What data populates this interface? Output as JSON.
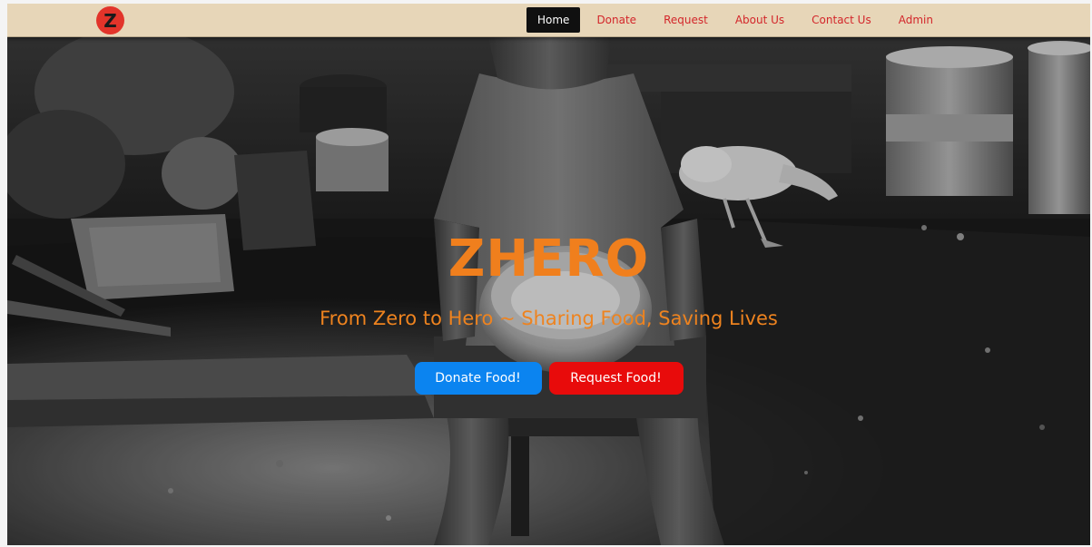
{
  "nav": {
    "logo_letter": "Z",
    "items": [
      {
        "label": "Home",
        "active": true
      },
      {
        "label": "Donate",
        "active": false
      },
      {
        "label": "Request",
        "active": false
      },
      {
        "label": "About Us",
        "active": false
      },
      {
        "label": "Contact Us",
        "active": false
      },
      {
        "label": "Admin",
        "active": false
      }
    ]
  },
  "hero": {
    "title": "ZHERO",
    "subtitle": "From Zero to Hero ~ Sharing Food, Saving Lives",
    "donate_button": "Donate Food!",
    "request_button": "Request Food!"
  },
  "colors": {
    "nav_background": "#e7d6b8",
    "nav_link": "#d3262a",
    "active_link_bg": "#101010",
    "accent_orange": "#f07f1d",
    "donate_blue": "#0b84f0",
    "request_red": "#e80b0b",
    "logo_red": "#e2342a"
  }
}
